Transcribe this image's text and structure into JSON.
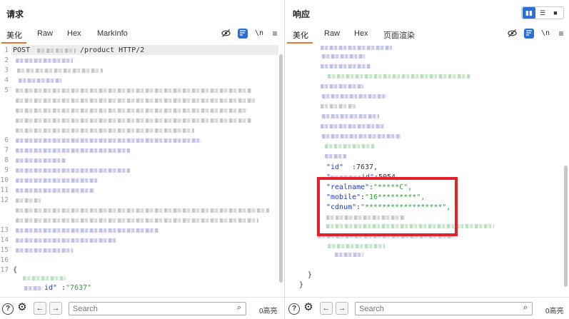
{
  "request": {
    "title": "请求",
    "tabs": [
      "美化",
      "Raw",
      "Hex",
      "MarkInfo"
    ],
    "active_tab": "美化",
    "tools": {
      "hide_icon": "eye-off-icon",
      "wrap_icon": "wrap-icon",
      "newline_label": "\\n",
      "menu_icon": "hamburger-menu-icon"
    },
    "line_numbers": [
      "1",
      "2",
      "3",
      "4",
      "5",
      "",
      "",
      "",
      "6",
      "7",
      "8",
      "9",
      "10",
      "11",
      "12",
      "",
      "",
      "13",
      "14",
      "15",
      "16",
      "17"
    ],
    "first_line": {
      "method": "POST",
      "path": "/product HTTP/2"
    },
    "body_open": "{",
    "body_key_suffix": "id\"",
    "body_colon": ":",
    "body_value": "\"7637\""
  },
  "response": {
    "title": "响应",
    "tabs": [
      "美化",
      "Raw",
      "Hex",
      "页面渲染"
    ],
    "active_tab": "美化",
    "tools": {
      "hide_icon": "eye-off-icon",
      "wrap_icon": "wrap-icon",
      "newline_label": "\\n",
      "menu_icon": "hamburger-menu-icon"
    },
    "view_toggles": [
      "split-columns-icon",
      "split-rows-icon",
      "single-view-icon"
    ],
    "fields": [
      {
        "key": "\"id\"",
        "sep": ":",
        "value": "7637,",
        "value_kind": "number"
      },
      {
        "key": "\"realname\"",
        "sep": ":",
        "value": "\"*****C\",",
        "value_kind": "string"
      },
      {
        "key": "\"mobile\"",
        "sep": ":",
        "value": "\"16*********\",",
        "value_kind": "string"
      },
      {
        "key": "\"cdnum\"",
        "sep": ":",
        "value": "\"******************\",",
        "value_kind": "string"
      }
    ],
    "partial_line": {
      "key_tail": "id\"",
      "sep": ":",
      "value": "5054,",
      "key_prefix": "\""
    },
    "close_inner": "}",
    "close_outer": "}"
  },
  "statusbar": {
    "help_icon": "help-icon",
    "settings_icon": "gear-icon",
    "back_icon": "arrow-left-icon",
    "forward_icon": "arrow-right-icon",
    "search_placeholder": "Search",
    "search_icon": "magnifier-icon",
    "highlights_label": "0高亮"
  },
  "colors": {
    "accent_blue": "#2a6fd6",
    "tab_underline": "#e8742c",
    "annotation_red": "#e5202a",
    "json_key": "#1e3ab8",
    "json_string": "#2e9e3b"
  }
}
